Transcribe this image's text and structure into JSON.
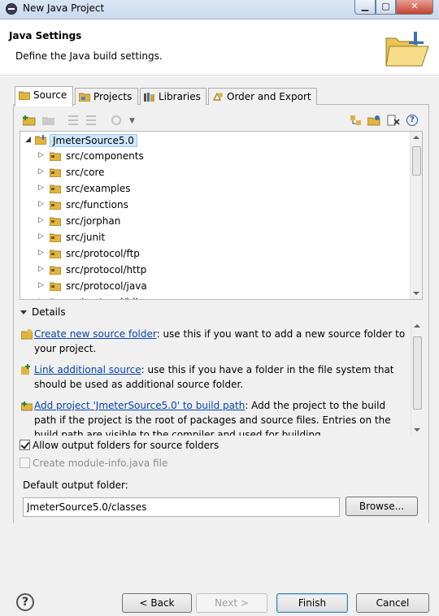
{
  "window": {
    "title": "New Java Project"
  },
  "header": {
    "title": "Java Settings",
    "description": "Define the Java build settings."
  },
  "tabs": [
    {
      "label": "Source"
    },
    {
      "label": "Projects"
    },
    {
      "label": "Libraries"
    },
    {
      "label": "Order and Export"
    }
  ],
  "tree": {
    "root": "JmeterSource5.0",
    "items": [
      "src/components",
      "src/core",
      "src/examples",
      "src/functions",
      "src/jorphan",
      "src/junit",
      "src/protocol/ftp",
      "src/protocol/http",
      "src/protocol/java",
      "src/protocol/jdbc"
    ]
  },
  "details": {
    "label": "Details",
    "items": [
      {
        "link": "Create new source folder",
        "text": ": use this if you want to add a new source folder to your project."
      },
      {
        "link": "Link additional source",
        "text": ": use this if you have a folder in the file system that should be used as additional source folder."
      },
      {
        "link": "Add project 'JmeterSource5.0' to build path",
        "text": ": Add the project to the build path if the project is the root of packages and source files. Entries on the build path are visible to the compiler and used for building."
      }
    ]
  },
  "options": {
    "allow_output": "Allow output folders for source folders",
    "create_module": "Create module-info.java file"
  },
  "output": {
    "label": "Default output folder:",
    "value": "JmeterSource5.0/classes",
    "browse": "Browse..."
  },
  "footer": {
    "help": "?",
    "back": "< Back",
    "next": "Next >",
    "finish": "Finish",
    "cancel": "Cancel"
  }
}
